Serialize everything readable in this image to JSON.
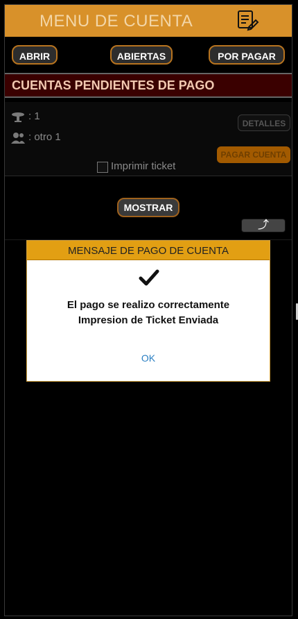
{
  "header": {
    "title": "MENU DE CUENTA",
    "icon": "edit-document-icon"
  },
  "tabs": [
    {
      "label": "ABRIR"
    },
    {
      "label": "ABIERTAS"
    },
    {
      "label": "POR PAGAR"
    }
  ],
  "section": {
    "title": "CUENTAS PENDIENTES DE PAGO"
  },
  "account": {
    "table_value": ": 1",
    "client_value": ": otro 1",
    "details_label": "DETALLES",
    "pay_label": "PAGAR CUENTA",
    "print_label": "Imprimir ticket"
  },
  "controls": {
    "show_label": "MOSTRAR",
    "up_symbol": "⤴"
  },
  "modal": {
    "title": "MENSAJE DE PAGO DE CUENTA",
    "line1": "El pago se realizo correctamente",
    "line2": "Impresion de Ticket Enviada",
    "ok_label": "OK"
  },
  "colors": {
    "accent": "#d8912a",
    "modal_header": "#e29f13",
    "section_bar": "#3a0000",
    "link": "#2a7fc3"
  }
}
